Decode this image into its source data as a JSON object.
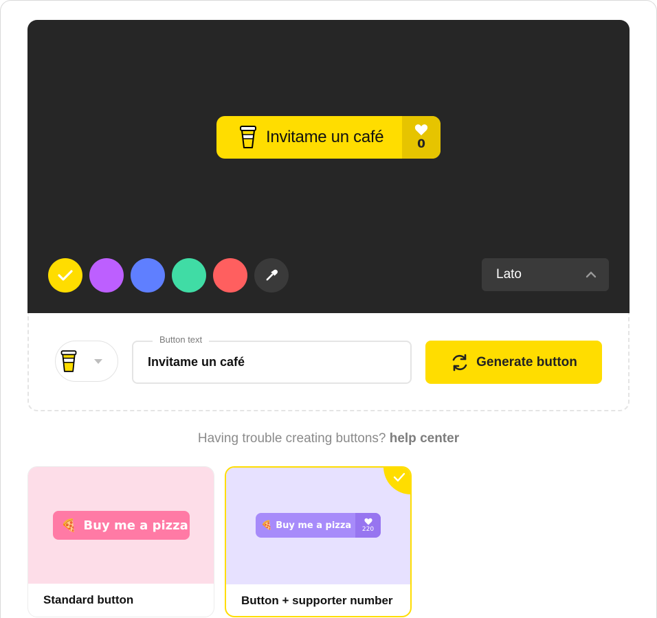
{
  "preview": {
    "button_text": "Invitame un café",
    "like_count": "0",
    "button_color": "#FFDD00"
  },
  "swatches": [
    {
      "name": "yellow",
      "color": "#FFDD00",
      "selected": true
    },
    {
      "name": "purple",
      "color": "#BD5FFF",
      "selected": false
    },
    {
      "name": "blue",
      "color": "#5F7FFF",
      "selected": false
    },
    {
      "name": "green",
      "color": "#40DCA5",
      "selected": false
    },
    {
      "name": "red",
      "color": "#FF5F5F",
      "selected": false
    }
  ],
  "font_select": {
    "value": "Lato"
  },
  "editor": {
    "emoji_icon": "coffee-cup-icon",
    "text_label": "Button text",
    "text_value": "Invitame un café",
    "generate_label": "Generate button"
  },
  "help": {
    "prefix": "Having trouble creating buttons?",
    "link": "help center"
  },
  "cards": [
    {
      "caption": "Standard button",
      "button_text": "Buy me a pizza",
      "bg": "#FDDDE8",
      "button_color": "#FF7AA5",
      "selected": false
    },
    {
      "caption": "Button + supporter number",
      "button_text": "Buy me a pizza",
      "count": "220",
      "bg": "#E7E1FF",
      "button_color": "#A78BFA",
      "selected": true
    }
  ]
}
